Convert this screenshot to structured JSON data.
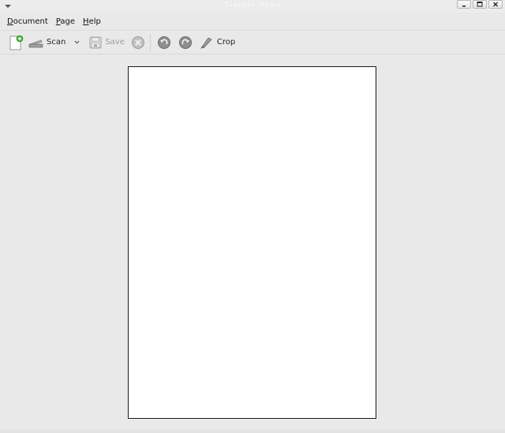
{
  "window": {
    "title": "Simple Scan",
    "controls": [
      "minimize",
      "maximize",
      "close"
    ]
  },
  "menubar": {
    "items": [
      {
        "first": "D",
        "rest": "ocument"
      },
      {
        "first": "P",
        "rest": "age"
      },
      {
        "first": "H",
        "rest": "elp"
      }
    ]
  },
  "toolbar": {
    "new_document_icon": "new-document-icon",
    "scan_label": "Scan",
    "save_label": "Save",
    "crop_label": "Crop",
    "save_enabled": false,
    "stop_enabled": false
  },
  "colors": {
    "background": "#e9e9e9",
    "page": "#ffffff",
    "new_doc_badge": "#3cae2f",
    "disabled_text": "#9c9c9c"
  },
  "document": {
    "pages": 1
  }
}
